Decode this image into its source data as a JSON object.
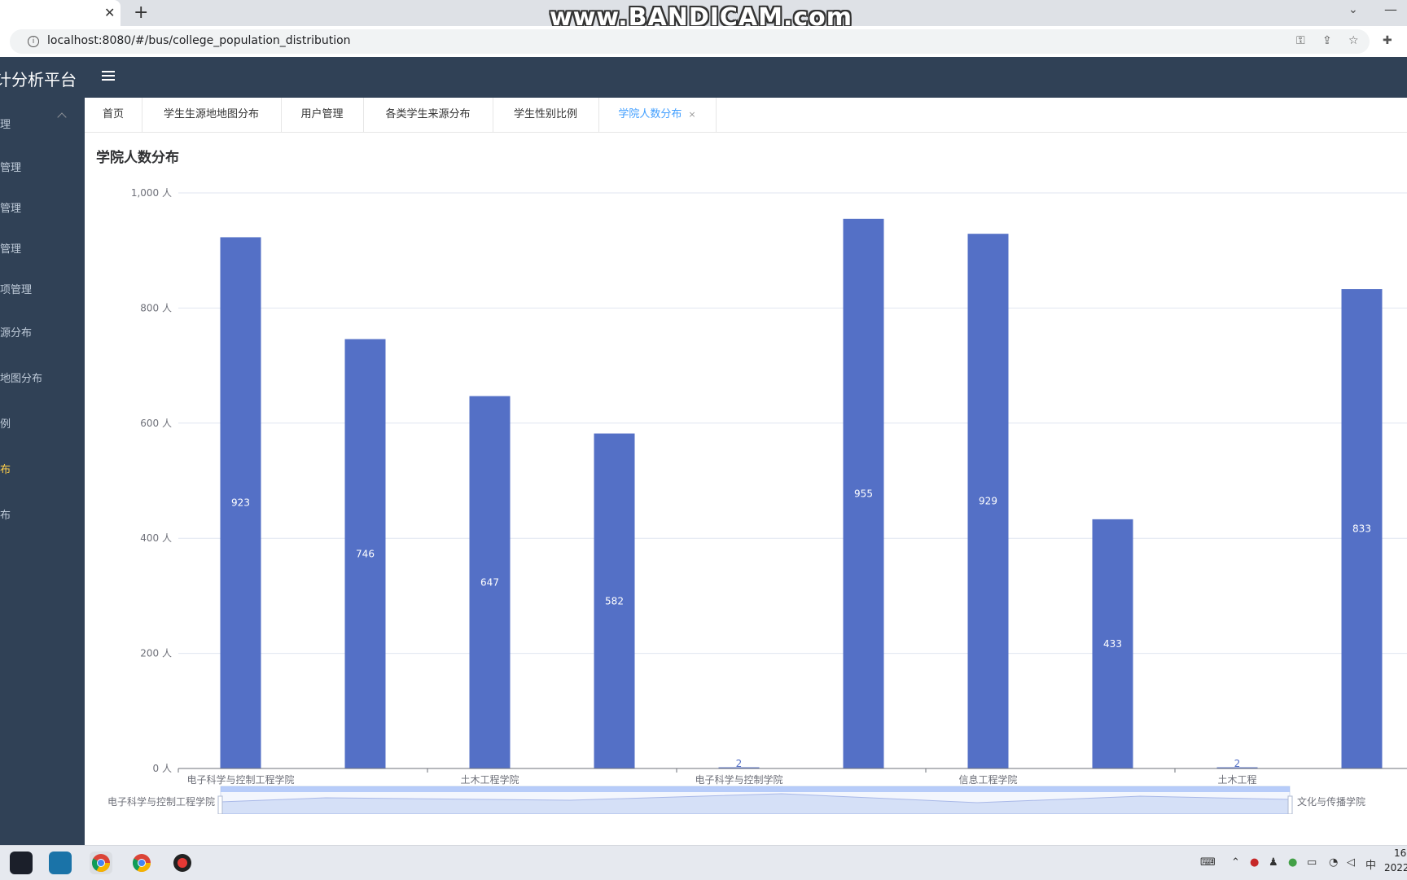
{
  "browser": {
    "url": "localhost:8080/#/bus/college_population_distribution",
    "watermark": "www.BANDICAM.com"
  },
  "app": {
    "title": "统计分析平台",
    "title_visible": "计分析平台"
  },
  "sidebar": {
    "items": [
      {
        "label": "理"
      },
      {
        "label": "管理"
      },
      {
        "label": "管理"
      },
      {
        "label": "管理"
      },
      {
        "label": "项管理"
      },
      {
        "label": "源分布"
      },
      {
        "label": "地图分布"
      },
      {
        "label": "例"
      },
      {
        "label": "布",
        "active": true
      },
      {
        "label": "布"
      }
    ]
  },
  "tags": [
    {
      "label": "首页"
    },
    {
      "label": "学生生源地地图分布"
    },
    {
      "label": "用户管理"
    },
    {
      "label": "各类学生来源分布"
    },
    {
      "label": "学生性别比例"
    },
    {
      "label": "学院人数分布",
      "active": true,
      "close": "×"
    }
  ],
  "page": {
    "title": "学院人数分布"
  },
  "chart_data": {
    "type": "bar",
    "unit": "人",
    "ylim": [
      0,
      1000
    ],
    "yticks": [
      "0 人",
      "200 人",
      "400 人",
      "600 人",
      "800 人",
      "1,000 人"
    ],
    "values": [
      923,
      746,
      647,
      582,
      2,
      955,
      929,
      433,
      2,
      833
    ],
    "value_labels": [
      "923",
      "746",
      "647",
      "582",
      "2",
      "955",
      "929",
      "433",
      "2",
      "833"
    ],
    "x_labels": [
      {
        "label": "电子科学与控制工程学院",
        "index": 0
      },
      {
        "label": "土木工程学院",
        "index": 2
      },
      {
        "label": "电子科学与控制学院",
        "index": 4
      },
      {
        "label": "信息工程学院",
        "index": 6
      },
      {
        "label": "土木工程",
        "index": 8
      }
    ],
    "datazoom": {
      "start_label": "电子科学与控制工程学院",
      "end_label": "文化与传播学院"
    },
    "bar_color": "#5470c6",
    "grid": true
  },
  "taskbar": {
    "clock_time": "16",
    "clock_date": "2022"
  }
}
